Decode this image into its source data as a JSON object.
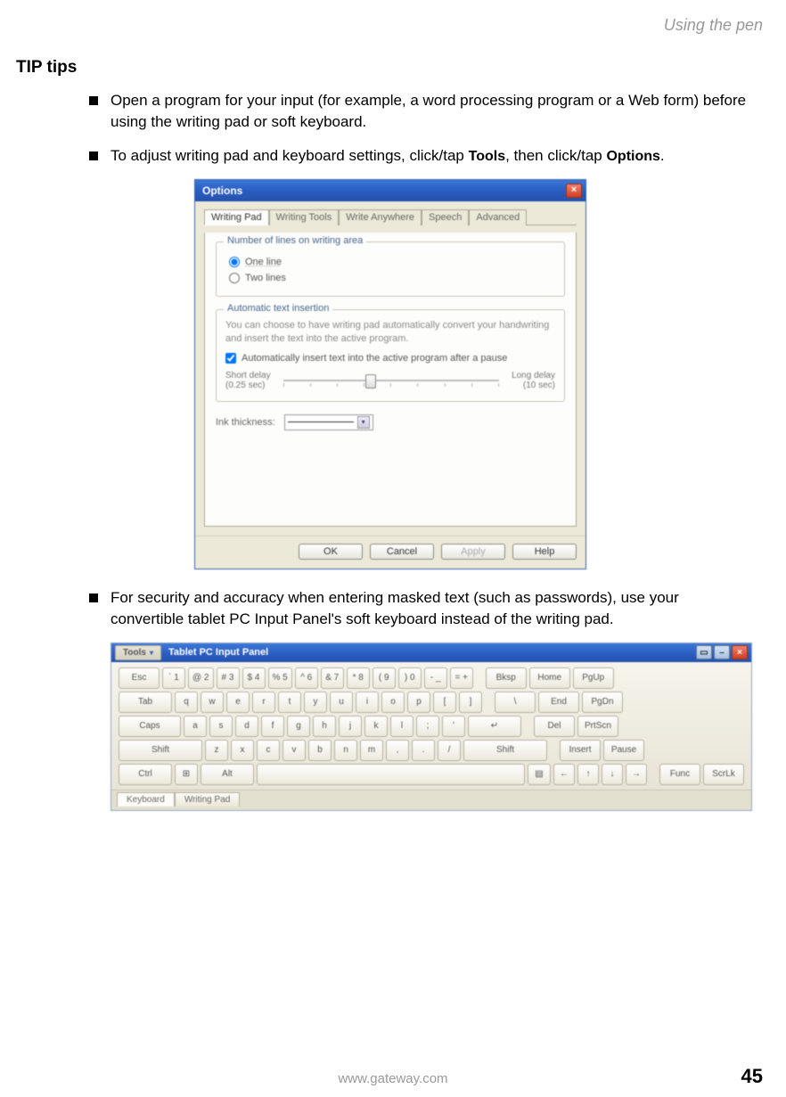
{
  "header": {
    "breadcrumb": "Using the pen"
  },
  "section": {
    "title": "TIP tips"
  },
  "bullets": {
    "b1": "Open a program for your input (for example, a word processing program or a Web form) before using the writing pad or soft keyboard.",
    "b2a": "To adjust writing pad and keyboard settings, click/tap ",
    "b2b": "Tools",
    "b2c": ", then click/tap ",
    "b2d": "Options",
    "b2e": ".",
    "b3": "For security and accuracy when entering masked text (such as passwords), use your convertible tablet PC Input Panel's soft keyboard instead of the writing pad."
  },
  "options": {
    "title": "Options",
    "tabs": [
      "Writing Pad",
      "Writing Tools",
      "Write Anywhere",
      "Speech",
      "Advanced"
    ],
    "group1": {
      "title": "Number of lines on writing area",
      "r1": "One line",
      "r2": "Two lines"
    },
    "group2": {
      "title": "Automatic text insertion",
      "desc": "You can choose to have writing pad automatically convert your handwriting and insert the text into the active program.",
      "check": "Automatically insert text into the active program after a pause",
      "left": "Short delay",
      "leftSub": "(0.25 sec)",
      "right": "Long delay",
      "rightSub": "(10 sec)"
    },
    "ink": {
      "label": "Ink thickness:"
    },
    "buttons": {
      "ok": "OK",
      "cancel": "Cancel",
      "apply": "Apply",
      "help": "Help"
    }
  },
  "keyboard": {
    "tools": "Tools",
    "title": "Tablet PC Input Panel",
    "row1": [
      "Esc",
      "`  1",
      "@ 2",
      "# 3",
      "$ 4",
      "% 5",
      "^ 6",
      "& 7",
      "* 8",
      "( 9",
      ") 0",
      "- _",
      "= +"
    ],
    "row1b": [
      "Bksp",
      "Home",
      "PgUp"
    ],
    "row2a": "Tab",
    "row2": [
      "q",
      "w",
      "e",
      "r",
      "t",
      "y",
      "u",
      "i",
      "o",
      "p",
      "[",
      "]"
    ],
    "row2b": [
      "\\",
      "End",
      "PgDn"
    ],
    "row3a": "Caps",
    "row3": [
      "a",
      "s",
      "d",
      "f",
      "g",
      "h",
      "j",
      "k",
      "l",
      ";",
      "'"
    ],
    "row3enter": "↵",
    "row3b": [
      "Del",
      "PrtScn"
    ],
    "row4a": "Shift",
    "row4": [
      "z",
      "x",
      "c",
      "v",
      "b",
      "n",
      "m",
      ",",
      ".",
      "/"
    ],
    "row4shift": "Shift",
    "row4b": [
      "Insert",
      "Pause"
    ],
    "row5": {
      "ctrl": "Ctrl",
      "win": "⊞",
      "alt": "Alt",
      "menu": "▤",
      "left": "←",
      "up": "↑",
      "down": "↓",
      "right": "→",
      "func": "Func",
      "scrlk": "ScrLk"
    },
    "tabs": [
      "Keyboard",
      "Writing Pad"
    ]
  },
  "footer": {
    "url": "www.gateway.com",
    "page": "45"
  }
}
